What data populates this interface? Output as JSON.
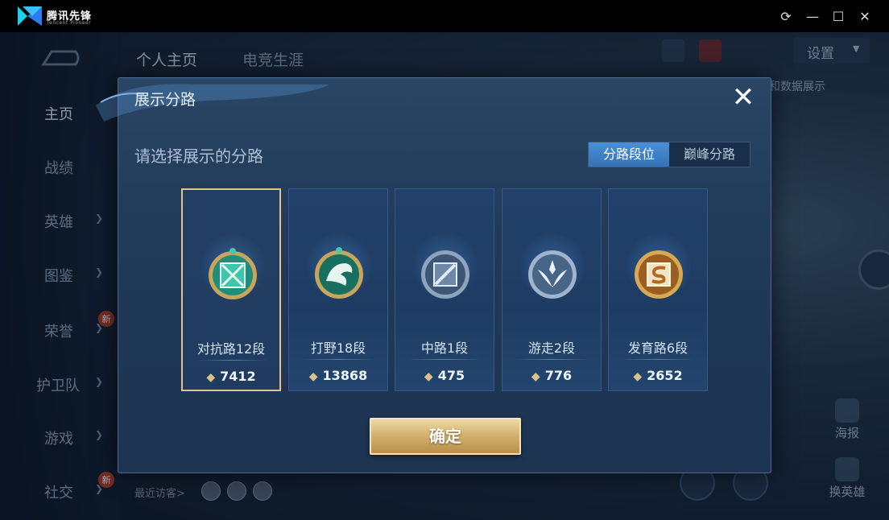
{
  "window": {
    "app_name": "腾讯先锋",
    "app_subtitle": "Tencent Pioneer",
    "buttons": [
      "refresh",
      "minimize",
      "maximize",
      "close"
    ]
  },
  "background": {
    "top_tabs": [
      "个人主页",
      "电竞生涯"
    ],
    "settings_label": "设置",
    "partial_text": "和数据展示",
    "nav": [
      {
        "label": "主页",
        "active": true,
        "chevron": false,
        "new": false
      },
      {
        "label": "战绩",
        "active": false,
        "chevron": false,
        "new": false
      },
      {
        "label": "英雄",
        "active": false,
        "chevron": true,
        "new": false
      },
      {
        "label": "图鉴",
        "active": false,
        "chevron": true,
        "new": false
      },
      {
        "label": "荣誉",
        "active": false,
        "chevron": true,
        "new": true
      },
      {
        "label": "护卫队",
        "active": false,
        "chevron": true,
        "new": false
      },
      {
        "label": "游戏",
        "active": false,
        "chevron": true,
        "new": false
      },
      {
        "label": "社交",
        "active": false,
        "chevron": true,
        "new": true
      }
    ],
    "new_badge": "新",
    "recent_visitors": "最近访客>",
    "side_buttons": [
      "海报",
      "换英雄"
    ]
  },
  "dialog": {
    "title": "展示分路",
    "prompt": "请选择展示的分路",
    "close_symbol": "✕",
    "segments": [
      {
        "label": "分路段位",
        "active": true
      },
      {
        "label": "巅峰分路",
        "active": false
      }
    ],
    "cards": [
      {
        "name": "对抗路12段",
        "score": "7412",
        "selected": true,
        "emblem": "clash-lane-emblem",
        "color": "#2fb39a"
      },
      {
        "name": "打野18段",
        "score": "13868",
        "selected": false,
        "emblem": "jungle-emblem",
        "color": "#1f8f7a"
      },
      {
        "name": "中路1段",
        "score": "475",
        "selected": false,
        "emblem": "mid-lane-emblem",
        "color": "#6f86a6"
      },
      {
        "name": "游走2段",
        "score": "776",
        "selected": false,
        "emblem": "roam-emblem",
        "color": "#8aa6c8"
      },
      {
        "name": "发育路6段",
        "score": "2652",
        "selected": false,
        "emblem": "farm-lane-emblem",
        "color": "#c98a3a"
      }
    ],
    "confirm_label": "确定"
  }
}
